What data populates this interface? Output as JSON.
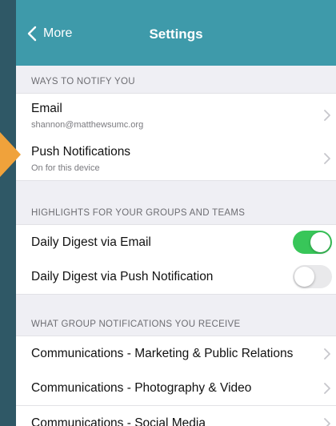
{
  "nav": {
    "back_label": "More",
    "title": "Settings"
  },
  "sections": [
    {
      "header": "WAYS TO NOTIFY YOU",
      "rows": [
        {
          "title": "Email",
          "subtitle": "shannon@matthewsumc.org"
        },
        {
          "title": "Push Notifications",
          "subtitle": "On for this device"
        }
      ]
    },
    {
      "header": "HIGHLIGHTS FOR YOUR GROUPS AND TEAMS",
      "rows": [
        {
          "title": "Daily Digest via Email",
          "toggle": "on"
        },
        {
          "title": "Daily Digest via Push Notification",
          "toggle": "off"
        }
      ]
    },
    {
      "header": "WHAT GROUP NOTIFICATIONS YOU RECEIVE",
      "rows": [
        {
          "title": "Communications - Marketing & Public Relations"
        },
        {
          "title": "Communications - Photography & Video"
        },
        {
          "title": "Communications - Social Media"
        }
      ]
    }
  ],
  "colors": {
    "navbar": "#3e9aaa",
    "toggle_on": "#38c659",
    "pointer": "#f0a23b",
    "background": "#2f5866"
  },
  "icons": {
    "back": "chevron-left-icon",
    "disclosure": "chevron-right-icon"
  }
}
